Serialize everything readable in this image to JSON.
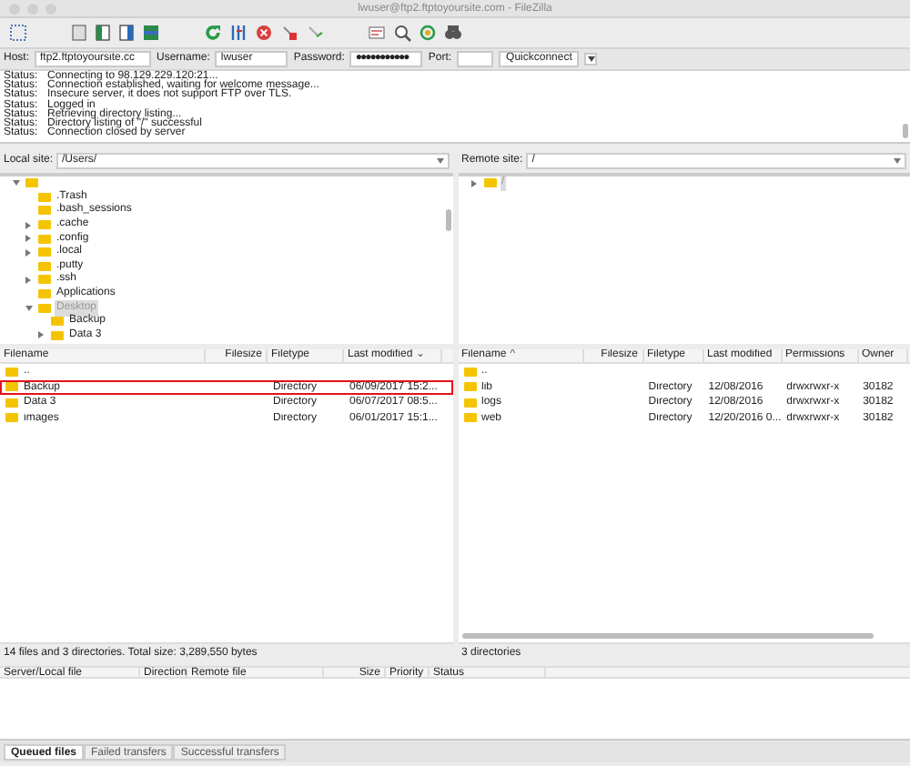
{
  "window": {
    "title": "lwuser@ftp2.ftptoyoursite.com - FileZilla"
  },
  "quickconnect": {
    "host_label": "Host:",
    "host": "ftp2.ftptoyoursite.cc",
    "username_label": "Username:",
    "username": "lwuser",
    "password_label": "Password:",
    "password": "●●●●●●●●●●●",
    "port_label": "Port:",
    "button": "Quickconnect"
  },
  "log": [
    {
      "label": "Status:",
      "message": "Connecting to 98.129.229.120:21..."
    },
    {
      "label": "Status:",
      "message": "Connection established, waiting for welcome message..."
    },
    {
      "label": "Status:",
      "message": "Insecure server, it does not support FTP over TLS."
    },
    {
      "label": "Status:",
      "message": "Logged in"
    },
    {
      "label": "Status:",
      "message": "Retrieving directory listing..."
    },
    {
      "label": "Status:",
      "message": "Directory listing of \"/\" successful"
    },
    {
      "label": "Status:",
      "message": "Connection closed by server"
    }
  ],
  "local": {
    "site_label": "Local site:",
    "path": "/Users/",
    "tree": [
      {
        "expanded": true,
        "children": [
          {
            "label": ".Trash",
            "selected": false
          },
          {
            "label": ".bash_sessions",
            "selected": false
          },
          {
            "label": ".cache",
            "expanded": false,
            "selected": false
          },
          {
            "label": ".config",
            "expanded": false,
            "selected": false
          },
          {
            "label": ".local",
            "expanded": false,
            "selected": false
          },
          {
            "label": ".putty",
            "selected": false
          },
          {
            "label": ".ssh",
            "expanded": false,
            "selected": false
          },
          {
            "label": "Applications",
            "selected": false
          },
          {
            "label": "Desktop",
            "expanded": true,
            "selected": true,
            "children": [
              {
                "label": "Backup",
                "selected": false
              },
              {
                "label": "Data 3",
                "expanded": false,
                "selected": false
              }
            ]
          }
        ]
      }
    ],
    "columns": [
      {
        "label": "Filename"
      },
      {
        "label": "Filesize"
      },
      {
        "label": "Filetype"
      },
      {
        "label": "Last modified",
        "sort_arrow": "⌄"
      }
    ],
    "rows": [
      {
        "cells": [
          "..",
          "",
          "",
          ""
        ],
        "highlighted": false
      },
      {
        "cells": [
          "Backup",
          "",
          "Directory",
          "06/09/2017 15:2..."
        ],
        "highlighted": true
      },
      {
        "cells": [
          "Data 3",
          "",
          "Directory",
          "06/07/2017 08:5..."
        ],
        "highlighted": false
      },
      {
        "cells": [
          "images",
          "",
          "Directory",
          "06/01/2017 15:1..."
        ],
        "highlighted": false
      }
    ],
    "status": "14 files and 3 directories. Total size: 3,289,550 bytes"
  },
  "remote": {
    "site_label": "Remote site:",
    "path": "/",
    "tree": [
      {
        "label": "/",
        "expanded": false,
        "selected": true
      }
    ],
    "columns": [
      {
        "label": "Filename",
        "sort_arrow": "^"
      },
      {
        "label": "Filesize"
      },
      {
        "label": "Filetype"
      },
      {
        "label": "Last modified"
      },
      {
        "label": "Permissions"
      },
      {
        "label": "Owner"
      }
    ],
    "rows": [
      {
        "cells": [
          "..",
          "",
          "",
          "",
          "",
          ""
        ],
        "highlighted": false
      },
      {
        "cells": [
          "lib",
          "",
          "Directory",
          "12/08/2016",
          "drwxrwxr-x",
          "30182"
        ],
        "highlighted": false
      },
      {
        "cells": [
          "logs",
          "",
          "Directory",
          "12/08/2016",
          "drwxrwxr-x",
          "30182"
        ],
        "highlighted": false
      },
      {
        "cells": [
          "web",
          "",
          "Directory",
          "12/20/2016 0...",
          "drwxrwxr-x",
          "30182"
        ],
        "highlighted": false
      }
    ],
    "status": "3 directories"
  },
  "queue": {
    "columns": [
      "Server/Local file",
      "Direction",
      "Remote file",
      "Size",
      "Priority",
      "Status"
    ],
    "tabs": [
      {
        "label": "Queued files",
        "selected": true
      },
      {
        "label": "Failed transfers",
        "selected": false
      },
      {
        "label": "Successful transfers",
        "selected": false
      }
    ]
  }
}
